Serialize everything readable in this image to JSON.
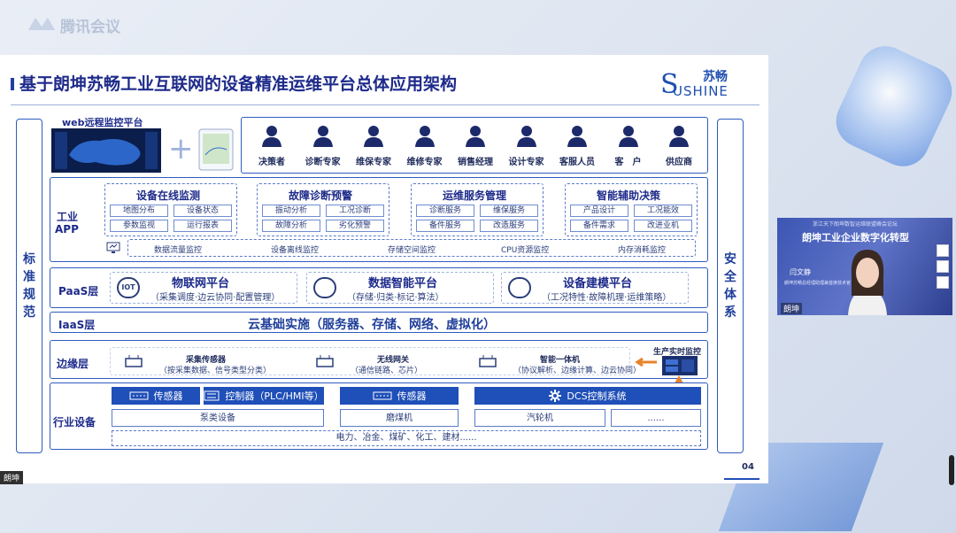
{
  "app": {
    "name": "腾讯会议"
  },
  "slide": {
    "title": "基于朗坤苏畅工业互联网的设备精准运维平台总体应用架构",
    "brand_cn": "苏畅",
    "brand_en": "USHINE",
    "brand_s": "S",
    "page": "04",
    "left_column": [
      "标",
      "准",
      "规",
      "范"
    ],
    "right_column": [
      "安",
      "全",
      "体",
      "系"
    ],
    "web_platform": "web远程监控平台",
    "plus": "+",
    "roles": [
      "决策者",
      "诊断专家",
      "维保专家",
      "维修专家",
      "销售经理",
      "设计专家",
      "客服人员",
      "客　户",
      "供应商"
    ],
    "app_layer": {
      "label_top": "工业",
      "label_bottom": "APP",
      "groups": [
        {
          "title": "设备在线监测",
          "items": [
            "地图分布",
            "设备状态",
            "参数监视",
            "运行报表"
          ]
        },
        {
          "title": "故障诊断预警",
          "items": [
            "振动分析",
            "工况诊断",
            "故障分析",
            "劣化预警"
          ]
        },
        {
          "title": "运维服务管理",
          "items": [
            "诊断服务",
            "维保服务",
            "备件服务",
            "改造服务"
          ]
        },
        {
          "title": "智能辅助决策",
          "items": [
            "产品设计",
            "工况能效",
            "备件需求",
            "改进业机"
          ]
        }
      ],
      "monitors": [
        "数据流量监控",
        "设备离线监控",
        "存储空间监控",
        "CPU资源监控",
        "内存消耗监控"
      ]
    },
    "paas": {
      "label": "PaaS层",
      "platforms": [
        {
          "name": "物联网平台",
          "desc": "（采集调度·边云协同·配置管理）",
          "icon": "IOT"
        },
        {
          "name": "数据智能平台",
          "desc": "（存储·归类·标记·算法）",
          "icon": ""
        },
        {
          "name": "设备建模平台",
          "desc": "（工况特性·故障机理·运维策略）",
          "icon": ""
        }
      ]
    },
    "iaas": {
      "label": "IaaS层",
      "text": "云基础实施（服务器、存储、网络、虚拟化）"
    },
    "edge": {
      "label": "边缘层",
      "items": [
        {
          "name": "采集传感器",
          "desc": "（按采集数据、信号类型分类）"
        },
        {
          "name": "无线网关",
          "desc": "（通信链路、芯片）"
        },
        {
          "name": "智能一体机",
          "desc": "（协议解析、边缘计算、边云协同）"
        }
      ],
      "realtime": "生产实时监控"
    },
    "industry": {
      "label": "行业设备",
      "sensor1": "传感器",
      "controller": "控制器（PLC/HMI等）",
      "sensor2": "传感器",
      "dcs": "DCS控制系统",
      "equip": [
        "泵类设备",
        "磨煤机",
        "汽轮机",
        "......"
      ],
      "industries": "电力、冶金、煤矿、化工、建材......"
    }
  },
  "video": {
    "banner_small": "浙江天下朗坤数智运维联盟峰会论坛",
    "banner": "朗坤工业企业数字化转型",
    "speaker": "闫文静",
    "speaker_title": "朗坤苏畅总经理助理兼首席技术官",
    "label": "朗坤"
  },
  "bottom_label": "朗坤"
}
